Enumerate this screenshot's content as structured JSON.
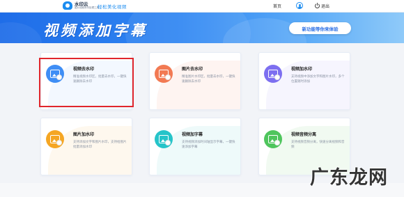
{
  "header": {
    "logo_name": "水印云",
    "logo_tagline": "图片视频水印处理工具",
    "slogan": "轻松美化视频",
    "nav_home": "首页",
    "logout": "退出"
  },
  "banner": {
    "title": "视频添加字幕",
    "button": "新功能等你来体验"
  },
  "cards": [
    {
      "title": "视频去水印",
      "desc": "精准视频水印区，批量去水印，一键快速删除去水印",
      "color": "#3f8ef5",
      "bg": "#e8f1ff",
      "icon": "video-icon"
    },
    {
      "title": "图片去水印",
      "desc": "精准图片水印区，批量去水印，一键快速删除去水印",
      "color": "#f27a53",
      "bg": "#fde9e3",
      "icon": "image-icon"
    },
    {
      "title": "视频加水印",
      "desc": "支持视频中添加文字和图片水印，多个位置随时添加",
      "color": "#7d6ff0",
      "bg": "#eeebfd",
      "icon": "video-icon"
    },
    {
      "title": "图片加水印",
      "desc": "支持添加文字和图片水印，支持给图片批量添加水印",
      "color": "#f5a623",
      "bg": "#fdf1dd",
      "icon": "image-icon"
    },
    {
      "title": "视频加字幕",
      "desc": "支持视频添加时间轴显示字幕，一键快速添加字幕",
      "color": "#26c4c9",
      "bg": "#ddf6f6",
      "icon": "video-icon"
    },
    {
      "title": "视频音频分离",
      "desc": "支持视频音频分离，快速分离视频和音频",
      "color": "#4fc55d",
      "bg": "#e3f6e4",
      "icon": "video-icon"
    }
  ],
  "watermark": "广东龙网"
}
